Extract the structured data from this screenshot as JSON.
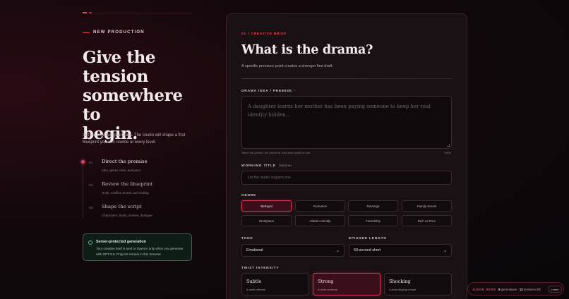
{
  "left": {
    "eyebrow": "NEW PRODUCTION",
    "hero_lines": [
      "Give the",
      "tension",
      "somewhere to",
      "begin."
    ],
    "lede": "Set the creative guardrails. The studio will shape a first blueprint you can rewrite at every level.",
    "steps": [
      {
        "num": "01",
        "title": "Direct the premise",
        "sub": "Idea, genre, tone, and pace"
      },
      {
        "num": "02",
        "title": "Review the blueprint",
        "sub": "Hook, conflict, reveal, and ending"
      },
      {
        "num": "03",
        "title": "Shape the script",
        "sub": "Characters, beats, scenes, dialogue"
      }
    ],
    "notice": {
      "title": "Server-protected generation",
      "body": "Your creative brief is sent to OpenAI only when you generate with GPT-5.6. Projects remain in this browser."
    }
  },
  "brief": {
    "kicker": "01 / CREATIVE BRIEF",
    "heading": "What is the drama?",
    "desc": "A specific pressure point creates a stronger first draft.",
    "idea": {
      "label": "DRAMA IDEA / PREMISE",
      "required_mark": "*",
      "placeholder": "A daughter learns her mother has been paying someone to keep her real identity hidden...",
      "hint": "Name the person, the pressure, and what could be lost.",
      "count": "0/800"
    },
    "title_field": {
      "label": "WORKING TITLE",
      "optional": "Optional",
      "placeholder": "Let the studio suggest one"
    },
    "genres": {
      "label": "GENRE",
      "items": [
        "Betrayal",
        "Romance",
        "Revenge",
        "Family Secret",
        "Workplace",
        "Hidden Identity",
        "Friendship",
        "Rich vs Poor"
      ],
      "selected": "Betrayal"
    },
    "tone": {
      "label": "TONE",
      "value": "Emotional"
    },
    "length": {
      "label": "EPISODE LENGTH",
      "value": "60-second short"
    },
    "intensity": {
      "label": "TWIST INTENSITY",
      "options": [
        {
          "name": "Subtle",
          "desc": "A quiet reframe"
        },
        {
          "name": "Strong",
          "desc": "A clear reversal"
        },
        {
          "name": "Shocking",
          "desc": "A story-flipping reveal"
        }
      ],
      "selected": "Strong"
    }
  },
  "demo": {
    "label": "JUDGE DEMO",
    "generations": "5",
    "generations_text": "generations",
    "revisions": "12",
    "revisions_text": "revisions left",
    "leave": "Leave"
  },
  "colors": {
    "accent": "#e0455f",
    "success": "#57c38b",
    "card": "#1a1114"
  }
}
